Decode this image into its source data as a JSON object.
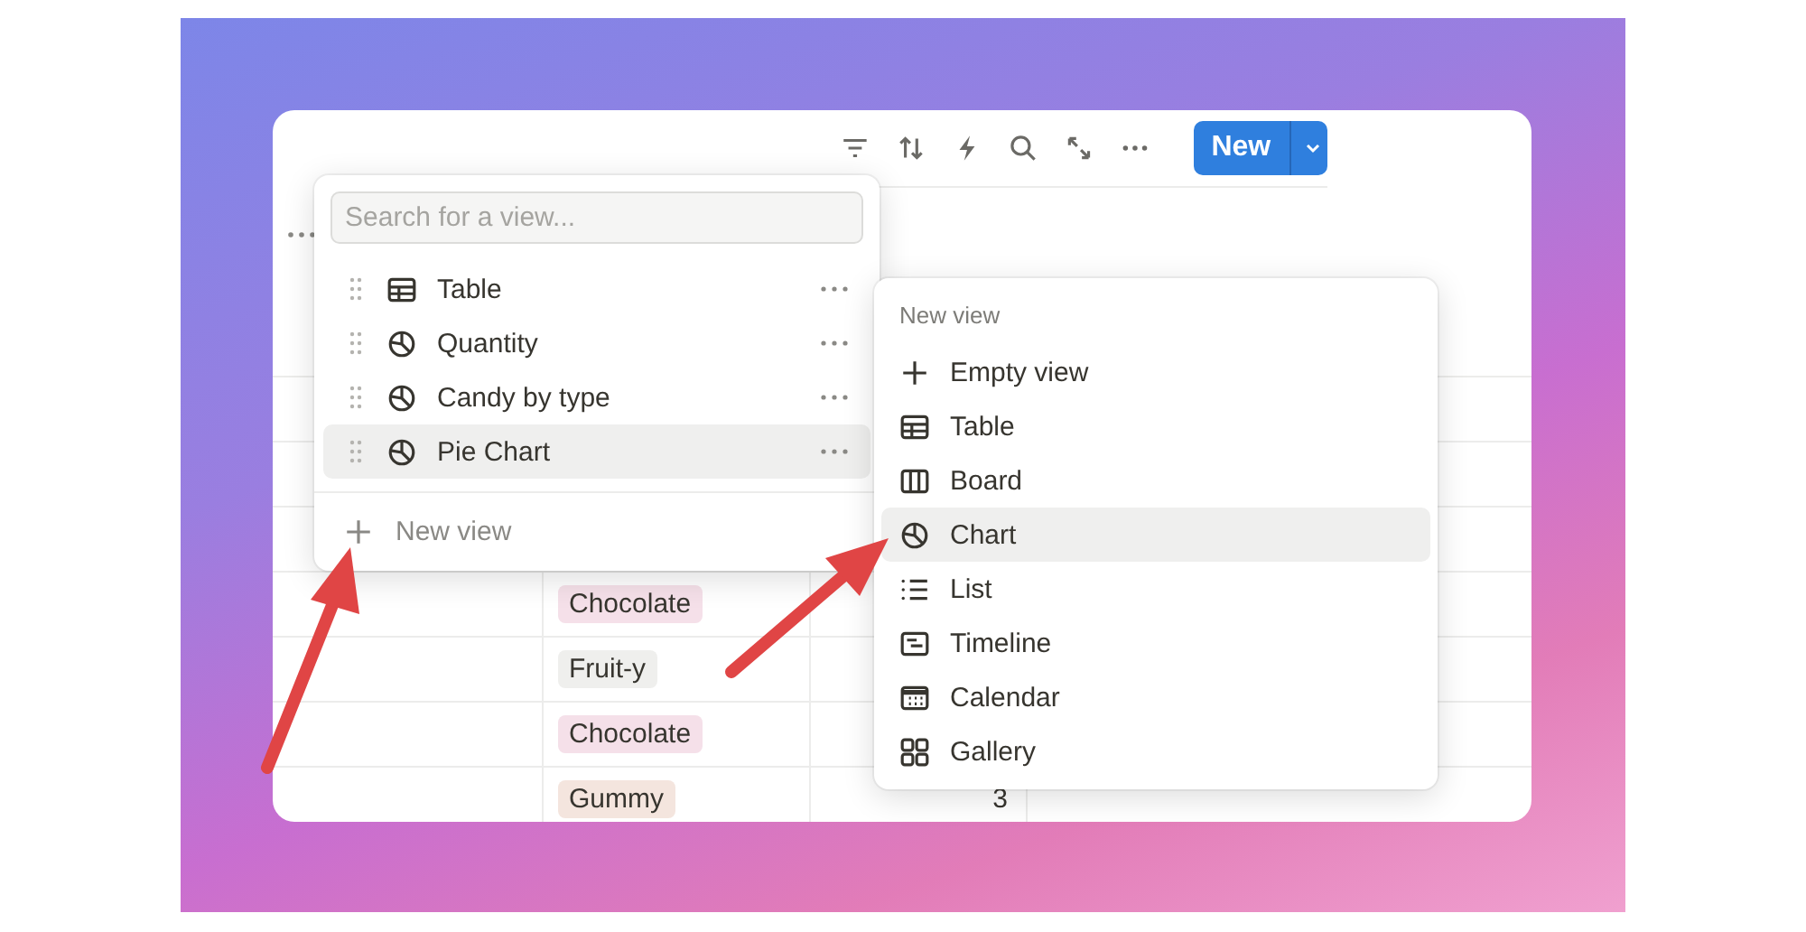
{
  "toolbar": {
    "new_button": {
      "label": "New"
    }
  },
  "table": {
    "rows": [
      {
        "tag": "Chocolate",
        "color": "#f5e0e9"
      },
      {
        "tag": "Fruit-y",
        "color": "#efefed"
      },
      {
        "tag": "Chocolate",
        "color": "#f5e0e9"
      },
      {
        "tag": "Gummy",
        "color": "#f4e5de",
        "quantity": "3"
      }
    ]
  },
  "view_menu": {
    "search": {
      "placeholder": "Search for a view..."
    },
    "views": [
      {
        "label": "Table",
        "kind": "table",
        "selected": false
      },
      {
        "label": "Quantity",
        "kind": "chart",
        "selected": false
      },
      {
        "label": "Candy by type",
        "kind": "chart",
        "selected": false
      },
      {
        "label": "Pie Chart",
        "kind": "chart",
        "selected": true
      }
    ],
    "add_label": "New view"
  },
  "new_view_menu": {
    "title": "New view",
    "options": [
      {
        "label": "Empty view",
        "kind": "plus",
        "selected": false
      },
      {
        "label": "Table",
        "kind": "table",
        "selected": false
      },
      {
        "label": "Board",
        "kind": "board",
        "selected": false
      },
      {
        "label": "Chart",
        "kind": "chart",
        "selected": true
      },
      {
        "label": "List",
        "kind": "list",
        "selected": false
      },
      {
        "label": "Timeline",
        "kind": "timeline",
        "selected": false
      },
      {
        "label": "Calendar",
        "kind": "calendar",
        "selected": false
      },
      {
        "label": "Gallery",
        "kind": "gallery",
        "selected": false
      }
    ]
  }
}
